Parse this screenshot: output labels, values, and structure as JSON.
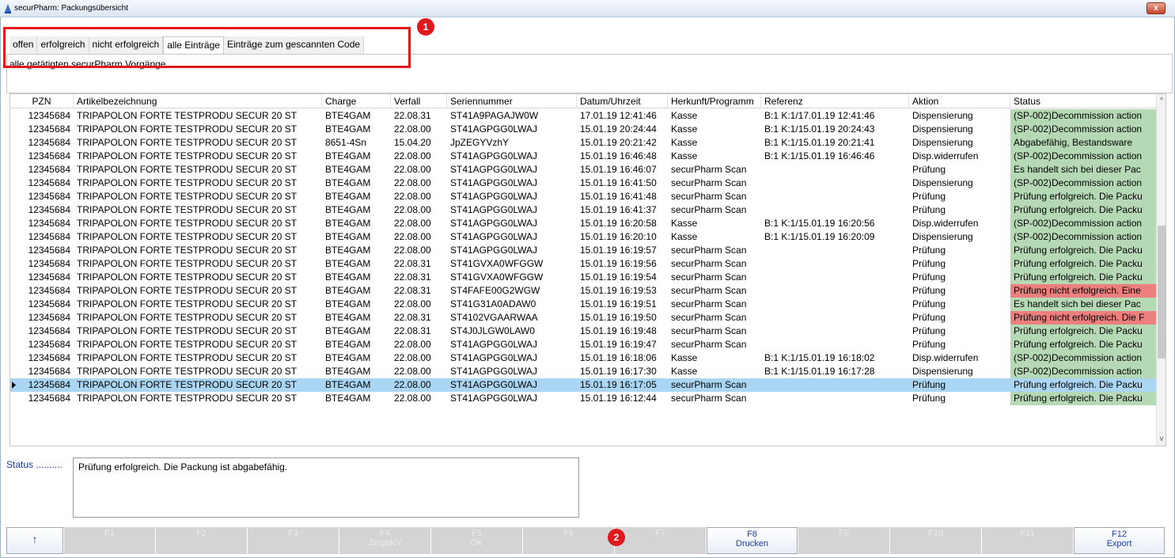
{
  "window": {
    "title": "securPharm: Packungsübersicht",
    "close_label": "x"
  },
  "tabs": [
    {
      "label": "offen",
      "active": false
    },
    {
      "label": "erfolgreich",
      "active": false
    },
    {
      "label": "nicht erfolgreich",
      "active": false
    },
    {
      "label": "alle Einträge",
      "active": true
    },
    {
      "label": "Einträge zum gescannten Code",
      "active": false
    }
  ],
  "description": "alle getätigten securPharm Vorgänge.",
  "markers": [
    "1",
    "2"
  ],
  "colors": {
    "status_green": "#b4d9b4",
    "status_red": "#ee7f7f",
    "selected_row": "#aad6f4",
    "highlight_red": "#e0191c"
  },
  "table": {
    "columns": [
      "PZN",
      "Artikelbezeichnung",
      "Charge",
      "Verfall",
      "Seriennummer",
      "Datum/Uhrzeit",
      "Herkunft/Programm",
      "Referenz",
      "Aktion",
      "Status"
    ],
    "rows": [
      {
        "pzn": "12345684",
        "artikel": "TRIPAPOLON FORTE TESTPRODU SECUR 20 ST",
        "charge": "BTE4GAM",
        "verfall": "22.08.31",
        "serie": "ST41A9PAGAJW0W",
        "datum": "17.01.19 12:41:46",
        "herkunft": "Kasse",
        "referenz": "B:1 K:1/17.01.19 12:41:46",
        "aktion": "Dispensierung",
        "status": "(SP-002)Decommission action",
        "status_color": "green"
      },
      {
        "pzn": "12345684",
        "artikel": "TRIPAPOLON FORTE TESTPRODU SECUR 20 ST",
        "charge": "BTE4GAM",
        "verfall": "22.08.00",
        "serie": "ST41AGPGG0LWAJ",
        "datum": "15.01.19 20:24:44",
        "herkunft": "Kasse",
        "referenz": "B:1 K:1/15.01.19 20:24:43",
        "aktion": "Dispensierung",
        "status": "(SP-002)Decommission action",
        "status_color": "green"
      },
      {
        "pzn": "12345684",
        "artikel": "TRIPAPOLON FORTE TESTPRODU SECUR 20 ST",
        "charge": "8651-4Sn",
        "verfall": "15.04.20",
        "serie": "JpZEGYVzhY",
        "datum": "15.01.19 20:21:42",
        "herkunft": "Kasse",
        "referenz": "B:1 K:1/15.01.19 20:21:41",
        "aktion": "Dispensierung",
        "status": "Abgabefähig, Bestandsware",
        "status_color": "green"
      },
      {
        "pzn": "12345684",
        "artikel": "TRIPAPOLON FORTE TESTPRODU SECUR 20 ST",
        "charge": "BTE4GAM",
        "verfall": "22.08.00",
        "serie": "ST41AGPGG0LWAJ",
        "datum": "15.01.19 16:46:48",
        "herkunft": "Kasse",
        "referenz": "B:1 K:1/15.01.19 16:46:46",
        "aktion": "Disp.widerrufen",
        "status": "(SP-002)Decommission action",
        "status_color": "green"
      },
      {
        "pzn": "12345684",
        "artikel": "TRIPAPOLON FORTE TESTPRODU SECUR 20 ST",
        "charge": "BTE4GAM",
        "verfall": "22.08.00",
        "serie": "ST41AGPGG0LWAJ",
        "datum": "15.01.19 16:46:07",
        "herkunft": "securPharm Scan",
        "referenz": "",
        "aktion": "Prüfung",
        "status": "Es handelt sich bei dieser Pac",
        "status_color": "green"
      },
      {
        "pzn": "12345684",
        "artikel": "TRIPAPOLON FORTE TESTPRODU SECUR 20 ST",
        "charge": "BTE4GAM",
        "verfall": "22.08.00",
        "serie": "ST41AGPGG0LWAJ",
        "datum": "15.01.19 16:41:50",
        "herkunft": "securPharm Scan",
        "referenz": "",
        "aktion": "Dispensierung",
        "status": "(SP-002)Decommission action",
        "status_color": "green"
      },
      {
        "pzn": "12345684",
        "artikel": "TRIPAPOLON FORTE TESTPRODU SECUR 20 ST",
        "charge": "BTE4GAM",
        "verfall": "22.08.00",
        "serie": "ST41AGPGG0LWAJ",
        "datum": "15.01.19 16:41:48",
        "herkunft": "securPharm Scan",
        "referenz": "",
        "aktion": "Prüfung",
        "status": "Prüfung erfolgreich. Die Packu",
        "status_color": "green"
      },
      {
        "pzn": "12345684",
        "artikel": "TRIPAPOLON FORTE TESTPRODU SECUR 20 ST",
        "charge": "BTE4GAM",
        "verfall": "22.08.00",
        "serie": "ST41AGPGG0LWAJ",
        "datum": "15.01.19 16:41:37",
        "herkunft": "securPharm Scan",
        "referenz": "",
        "aktion": "Prüfung",
        "status": "Prüfung erfolgreich. Die Packu",
        "status_color": "green"
      },
      {
        "pzn": "12345684",
        "artikel": "TRIPAPOLON FORTE TESTPRODU SECUR 20 ST",
        "charge": "BTE4GAM",
        "verfall": "22.08.00",
        "serie": "ST41AGPGG0LWAJ",
        "datum": "15.01.19 16:20:58",
        "herkunft": "Kasse",
        "referenz": "B:1 K:1/15.01.19 16:20:56",
        "aktion": "Disp.widerrufen",
        "status": "(SP-002)Decommission action",
        "status_color": "green"
      },
      {
        "pzn": "12345684",
        "artikel": "TRIPAPOLON FORTE TESTPRODU SECUR 20 ST",
        "charge": "BTE4GAM",
        "verfall": "22.08.00",
        "serie": "ST41AGPGG0LWAJ",
        "datum": "15.01.19 16:20:10",
        "herkunft": "Kasse",
        "referenz": "B:1 K:1/15.01.19 16:20:09",
        "aktion": "Dispensierung",
        "status": "(SP-002)Decommission action",
        "status_color": "green"
      },
      {
        "pzn": "12345684",
        "artikel": "TRIPAPOLON FORTE TESTPRODU SECUR 20 ST",
        "charge": "BTE4GAM",
        "verfall": "22.08.00",
        "serie": "ST41AGPGG0LWAJ",
        "datum": "15.01.19 16:19:57",
        "herkunft": "securPharm Scan",
        "referenz": "",
        "aktion": "Prüfung",
        "status": "Prüfung erfolgreich. Die Packu",
        "status_color": "green"
      },
      {
        "pzn": "12345684",
        "artikel": "TRIPAPOLON FORTE TESTPRODU SECUR 20 ST",
        "charge": "BTE4GAM",
        "verfall": "22.08.31",
        "serie": "ST41GVXA0WFGGW",
        "datum": "15.01.19 16:19:56",
        "herkunft": "securPharm Scan",
        "referenz": "",
        "aktion": "Prüfung",
        "status": "Prüfung erfolgreich. Die Packu",
        "status_color": "green"
      },
      {
        "pzn": "12345684",
        "artikel": "TRIPAPOLON FORTE TESTPRODU SECUR 20 ST",
        "charge": "BTE4GAM",
        "verfall": "22.08.31",
        "serie": "ST41GVXA0WFGGW",
        "datum": "15.01.19 16:19:54",
        "herkunft": "securPharm Scan",
        "referenz": "",
        "aktion": "Prüfung",
        "status": "Prüfung erfolgreich. Die Packu",
        "status_color": "green"
      },
      {
        "pzn": "12345684",
        "artikel": "TRIPAPOLON FORTE TESTPRODU SECUR 20 ST",
        "charge": "BTE4GAM",
        "verfall": "22.08.31",
        "serie": "ST4FAFE00G2WGW",
        "datum": "15.01.19 16:19:53",
        "herkunft": "securPharm Scan",
        "referenz": "",
        "aktion": "Prüfung",
        "status": "Prüfung nicht erfolgreich. Eine",
        "status_color": "red"
      },
      {
        "pzn": "12345684",
        "artikel": "TRIPAPOLON FORTE TESTPRODU SECUR 20 ST",
        "charge": "BTE4GAM",
        "verfall": "22.08.00",
        "serie": "ST41G31A0ADAW0",
        "datum": "15.01.19 16:19:51",
        "herkunft": "securPharm Scan",
        "referenz": "",
        "aktion": "Prüfung",
        "status": "Es handelt sich bei dieser Pac",
        "status_color": "green"
      },
      {
        "pzn": "12345684",
        "artikel": "TRIPAPOLON FORTE TESTPRODU SECUR 20 ST",
        "charge": "BTE4GAM",
        "verfall": "22.08.31",
        "serie": "ST4102VGAARWAA",
        "datum": "15.01.19 16:19:50",
        "herkunft": "securPharm Scan",
        "referenz": "",
        "aktion": "Prüfung",
        "status": "Prüfung nicht erfolgreich. Die F",
        "status_color": "red"
      },
      {
        "pzn": "12345684",
        "artikel": "TRIPAPOLON FORTE TESTPRODU SECUR 20 ST",
        "charge": "BTE4GAM",
        "verfall": "22.08.31",
        "serie": "ST4J0JLGW0LAW0",
        "datum": "15.01.19 16:19:48",
        "herkunft": "securPharm Scan",
        "referenz": "",
        "aktion": "Prüfung",
        "status": "Prüfung erfolgreich. Die Packu",
        "status_color": "green"
      },
      {
        "pzn": "12345684",
        "artikel": "TRIPAPOLON FORTE TESTPRODU SECUR 20 ST",
        "charge": "BTE4GAM",
        "verfall": "22.08.00",
        "serie": "ST41AGPGG0LWAJ",
        "datum": "15.01.19 16:19:47",
        "herkunft": "securPharm Scan",
        "referenz": "",
        "aktion": "Prüfung",
        "status": "Prüfung erfolgreich. Die Packu",
        "status_color": "green"
      },
      {
        "pzn": "12345684",
        "artikel": "TRIPAPOLON FORTE TESTPRODU SECUR 20 ST",
        "charge": "BTE4GAM",
        "verfall": "22.08.00",
        "serie": "ST41AGPGG0LWAJ",
        "datum": "15.01.19 16:18:06",
        "herkunft": "Kasse",
        "referenz": "B:1 K:1/15.01.19 16:18:02",
        "aktion": "Disp.widerrufen",
        "status": "(SP-002)Decommission action",
        "status_color": "green"
      },
      {
        "pzn": "12345684",
        "artikel": "TRIPAPOLON FORTE TESTPRODU SECUR 20 ST",
        "charge": "BTE4GAM",
        "verfall": "22.08.00",
        "serie": "ST41AGPGG0LWAJ",
        "datum": "15.01.19 16:17:30",
        "herkunft": "Kasse",
        "referenz": "B:1 K:1/15.01.19 16:17:28",
        "aktion": "Dispensierung",
        "status": "(SP-002)Decommission action",
        "status_color": "green"
      },
      {
        "pzn": "12345684",
        "artikel": "TRIPAPOLON FORTE TESTPRODU SECUR 20 ST",
        "charge": "BTE4GAM",
        "verfall": "22.08.00",
        "serie": "ST41AGPGG0LWAJ",
        "datum": "15.01.19 16:17:05",
        "herkunft": "securPharm Scan",
        "referenz": "",
        "aktion": "Prüfung",
        "status": "Prüfung erfolgreich. Die Packu",
        "status_color": "green",
        "selected": true
      },
      {
        "pzn": "12345684",
        "artikel": "TRIPAPOLON FORTE TESTPRODU SECUR 20 ST",
        "charge": "BTE4GAM",
        "verfall": "22.08.00",
        "serie": "ST41AGPGG0LWAJ",
        "datum": "15.01.19 16:12:44",
        "herkunft": "securPharm Scan",
        "referenz": "",
        "aktion": "Prüfung",
        "status": "Prüfung erfolgreich. Die Packu",
        "status_color": "green"
      }
    ]
  },
  "status_panel": {
    "label": "Status ..........",
    "text": "Prüfung erfolgreich. Die Packung ist abgabefähig."
  },
  "function_keys": [
    {
      "key": "↑",
      "action": "",
      "enabled": true
    },
    {
      "key": "F1",
      "action": "",
      "enabled": false
    },
    {
      "key": "F2",
      "action": "",
      "enabled": false
    },
    {
      "key": "F3",
      "action": "",
      "enabled": false
    },
    {
      "key": "F4",
      "action": "ZeigeKV",
      "enabled": false
    },
    {
      "key": "F5",
      "action": "OK",
      "enabled": false
    },
    {
      "key": "F6",
      "action": "",
      "enabled": false
    },
    {
      "key": "F7",
      "action": "",
      "enabled": false
    },
    {
      "key": "F8",
      "action": "Drucken",
      "enabled": true
    },
    {
      "key": "F9",
      "action": "",
      "enabled": false
    },
    {
      "key": "F10",
      "action": "",
      "enabled": false
    },
    {
      "key": "F11",
      "action": "",
      "enabled": false
    },
    {
      "key": "F12",
      "action": "Export",
      "enabled": true
    }
  ]
}
